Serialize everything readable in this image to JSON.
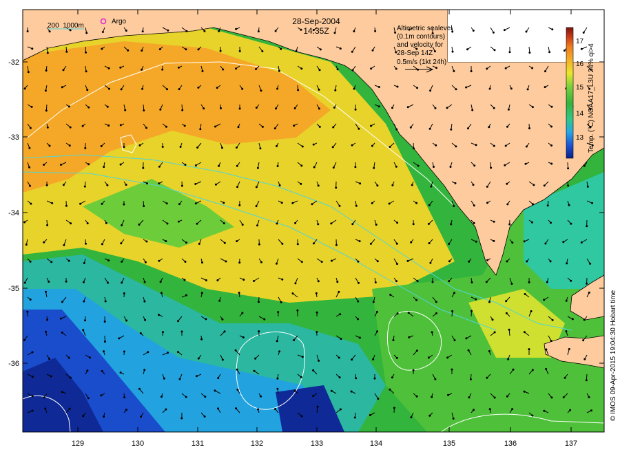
{
  "map": {
    "date": "28-Sep-2004",
    "time": "14:35Z",
    "legend_contours": "200  1000m",
    "legend_argo": "Argo",
    "velocity_note": [
      "Altimetric sealevel",
      "(0.1m contours)",
      "and velocity for",
      "28-Sep 14Z",
      "0.5m/s (1kt 24h)"
    ],
    "colorbar_title": "Temp. (°C) NOAA17_L3U 24% qi>4",
    "credit": "© IMOS 09-Apr-2015 19:04:30 Hobart time",
    "lat_labels": [
      "-32",
      "-33",
      "-34",
      "-35",
      "-36"
    ],
    "lon_labels": [
      "129",
      "130",
      "131",
      "132",
      "133",
      "134",
      "135",
      "136",
      "137"
    ],
    "colorbar_labels": [
      "17",
      "16",
      "15",
      "14",
      "13"
    ]
  },
  "colors": {
    "land": "#fdcb9d",
    "sst_ramp": [
      "#0a1f8a",
      "#1a55d8",
      "#23a8e8",
      "#30c88a",
      "#33b43c",
      "#7bd23c",
      "#e8e82a",
      "#f5b028",
      "#f0801e",
      "#c83a18",
      "#7a1410"
    ],
    "contour": "#ffffff",
    "isobath": "#4ed6d6",
    "argo_marker": "#e020e0"
  }
}
